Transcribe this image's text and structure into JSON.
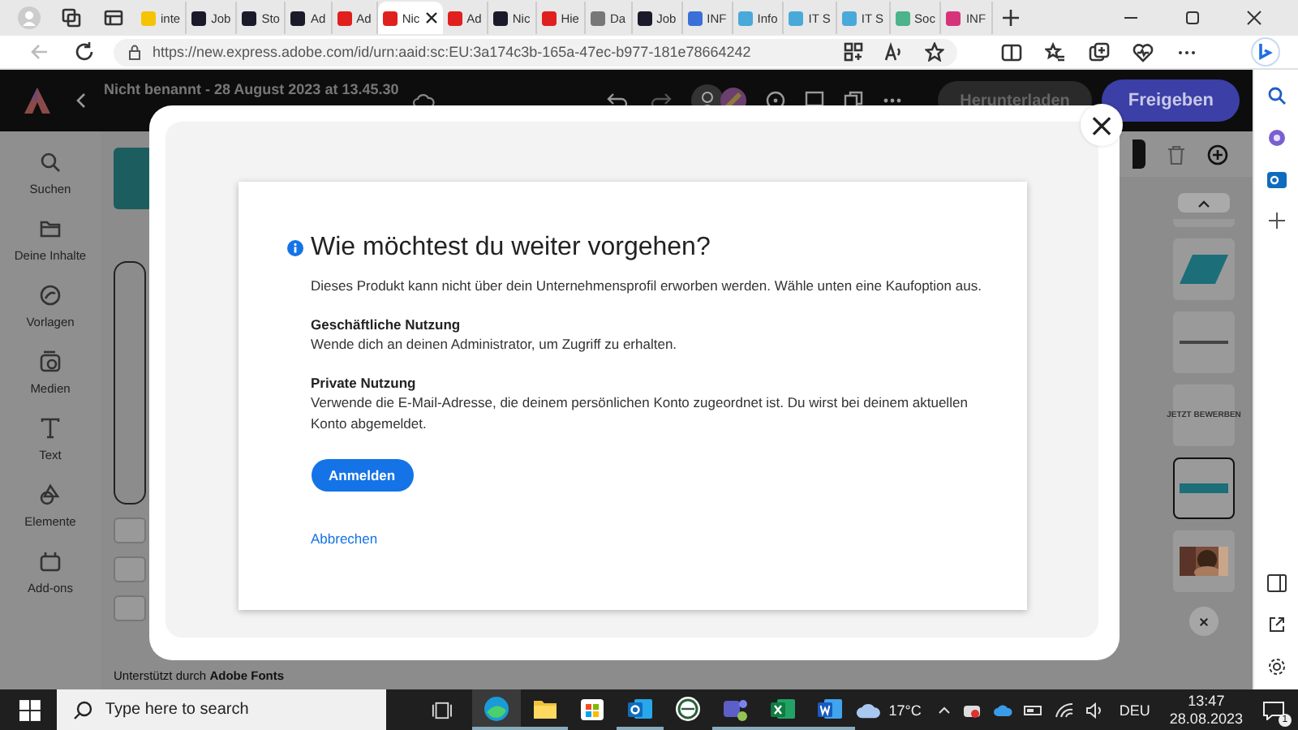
{
  "browser": {
    "tabs": [
      {
        "label": "inte",
        "kind": "yellow",
        "selected": false
      },
      {
        "label": "Job",
        "kind": "dark",
        "selected": false
      },
      {
        "label": "Sto",
        "kind": "dark",
        "selected": false
      },
      {
        "label": "Ad",
        "kind": "dark",
        "selected": false
      },
      {
        "label": "Ad",
        "kind": "red",
        "selected": false
      },
      {
        "label": "Nic",
        "kind": "red",
        "selected": true
      },
      {
        "label": "Ad",
        "kind": "red",
        "selected": false
      },
      {
        "label": "Nic",
        "kind": "dark",
        "selected": false
      },
      {
        "label": "Hie",
        "kind": "red",
        "selected": false
      },
      {
        "label": "Da",
        "kind": "grey",
        "selected": false
      },
      {
        "label": "Job",
        "kind": "dark",
        "selected": false
      },
      {
        "label": "INF",
        "kind": "doc",
        "selected": false
      },
      {
        "label": "Info",
        "kind": "wave",
        "selected": false
      },
      {
        "label": "IT S",
        "kind": "wave",
        "selected": false
      },
      {
        "label": "IT S",
        "kind": "wave",
        "selected": false
      },
      {
        "label": "Soc",
        "kind": "green",
        "selected": false
      },
      {
        "label": "INF",
        "kind": "insta",
        "selected": false
      }
    ],
    "url": "https://new.express.adobe.com/id/urn:aaid:sc:EU:3a174c3b-165a-47ec-b977-181e78664242"
  },
  "app": {
    "title": "Nicht benannt - 28 August 2023 at 13.45.30",
    "download": "Herunterladen",
    "share": "Freigeben",
    "rail": [
      {
        "label": "Suchen",
        "kind": "search"
      },
      {
        "label": "Deine Inhalte",
        "kind": "folder"
      },
      {
        "label": "Vorlagen",
        "kind": "templates"
      },
      {
        "label": "Medien",
        "kind": "media"
      },
      {
        "label": "Text",
        "kind": "text"
      },
      {
        "label": "Elemente",
        "kind": "shapes"
      },
      {
        "label": "Add-ons",
        "kind": "addons"
      }
    ],
    "footer": "Unterstützt durch **Adobe Fonts**",
    "pages": [
      {
        "kind": "shape",
        "selected": false
      },
      {
        "kind": "line",
        "selected": false
      },
      {
        "kind": "text",
        "text": "JETZT BEWERBEN",
        "selected": false
      },
      {
        "kind": "banner",
        "selected": true
      },
      {
        "kind": "picture",
        "selected": false
      }
    ]
  },
  "dialog": {
    "title": "Wie möchtest du weiter vorgehen?",
    "intro": "Dieses Produkt kann nicht über dein Unternehmensprofil erworben werden. Wähle unten eine Kaufoption aus.",
    "sections": [
      {
        "heading": "Geschäftliche Nutzung",
        "text": "Wende dich an deinen Administrator, um Zugriff zu erhalten."
      },
      {
        "heading": "Private Nutzung",
        "text": "Verwende die E-Mail-Adresse, die deinem persönlichen Konto zugeordnet ist. Du wirst bei deinem aktuellen Konto abgemeldet."
      }
    ],
    "primary": "Anmelden",
    "cancel": "Abbrechen",
    "close": "×"
  },
  "taskbar": {
    "search_placeholder": "Type here to search",
    "apps": [
      {
        "kind": "edge",
        "selected": true,
        "open": true
      },
      {
        "kind": "explorer",
        "selected": false,
        "open": true
      },
      {
        "kind": "store",
        "selected": false,
        "open": false
      },
      {
        "kind": "outlook",
        "selected": false,
        "open": true
      },
      {
        "kind": "circle",
        "selected": false,
        "open": false
      },
      {
        "kind": "teams",
        "selected": false,
        "open": true
      },
      {
        "kind": "excel",
        "selected": false,
        "open": true
      },
      {
        "kind": "word",
        "selected": false,
        "open": true
      }
    ],
    "temperature": "17°C",
    "language": "DEU",
    "time": "13:47",
    "date": "28.08.2023",
    "notifications": "1"
  }
}
